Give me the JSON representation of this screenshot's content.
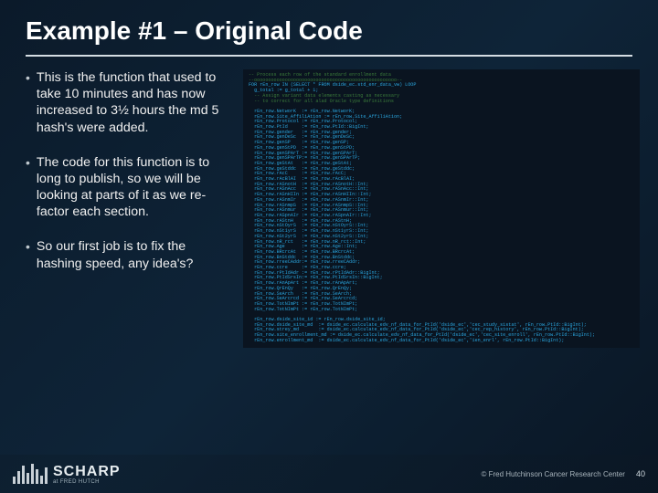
{
  "title": "Example #1 – Original Code",
  "bullets": [
    "This is the function that used to take 10 minutes and has now increased to 3½ hours the md 5 hash's were added.",
    "The code for this function is to long to publish, so we will be looking at parts of it as we re-factor each section.",
    "So our first job is to fix the hashing speed, any idea's?"
  ],
  "code": {
    "comment1": "-- Process each row of the standard enrollment data",
    "comment2": "--ooooooooooooooooooooooooooooooooooooooooooooooooooo--",
    "loop_open": "FOR rEn_row IN (SELECT * FROM dside_ec.std_enr_data_vw) LOOP",
    "counter": "  g_total := g_total + 1;",
    "comment3": "  -- Assign variant data elements casting as necessary",
    "comment4": "  -- to correct for all alad Oracle type definitions",
    "assigns": [
      "rEn_row.NetworK  := rEn_row.NetworK;",
      "rEn_row.Site_AffiliAtion := rEn_row.Site_AffiliAtion;",
      "rEn_row.Protocol := rEn_row.Protocol;",
      "rEn_row.PtId     := rEn_row.PtId::BigInt;",
      "rEn_row.gender   := rEn_row.gender;",
      "rEn_row.genDeSc  := rEn_row.genDeSc;",
      "rEn_row.genSP    := rEn_row.genSP;",
      "rEn_row.genStPD  := rEn_row.genStPD;",
      "rEn_row.genSPArT := rEn_row.genSPArT;",
      "rEn_row.genSPArTP:= rEn_row.genSPArTP;",
      "rEn_row.geStAt   := rEn_row.geStAt;",
      "rEn_row.geStddc  := rEn_row.geStddc;",
      "rEn_row.rAcC     := rEn_row.rAcC;",
      "rEn_row.rAcBlAI  := rEn_row.rAcBlAI;",
      "rEn_row.rASnotH  := rEn_row.rASnotH::Int;",
      "rEn_row.rASnAcc  := rEn_row.rASnAcc::Int;",
      "rEn_row.rASnHIIn := rEn_row.rASnHIIn::Int;",
      "rEn_row.rASnmIr  := rEn_row.rASnmIr::Int;",
      "rEn_row.rASnmpS  := rEn_row.rASnmpS::Int;",
      "rEn_row.rASnmur  := rEn_row.rASnmur::Int;",
      "rEn_row.rASpnAIr := rEn_row.rASpnAIr::Int;",
      "rEn_row.rAStnH   := rEn_row.rAStnH;",
      "rEn_row.nStOyrS  := rEn_row.nStOyrS::Int;",
      "rEn_row.nSt1yrS  := rEn_row.nSt1yrS::Int;",
      "rEn_row.nSt2yrS  := rEn_row.nSt2yrS::Int;",
      "rEn_row.nR_rct   := rEn_row.nR_rct::Int;",
      "rEn_row.Age      := rEn_row.Age::Int;",
      "rEn_row.BRcrcAt  := rEn_row.BRcrcAt;",
      "rEn_row.BnStddc  := rEn_row.BnStddc;",
      "rEn_row.rreeCAddr:= rEn_row.rreeCAddr;",
      "rEn_row.ccre     := rEn_row.ccre;",
      "rEn_row.rPtIdAdr := rEn_row.rPtIdAdr::BigInt;",
      "rEn_row.PtIdSrsIn:= rEn_row.PtIdSrsIn::BigInt;",
      "rEn_row.rAnApArt := rEn_row.rAnApArt;",
      "rEn_row.QrEnQy   := rEn_row.QrEnQy;",
      "rEn_row.SeArch   := rEn_row.SeArch;",
      "rEn_row.SeArcrcd := rEn_row.SeArcrcd;",
      "rEn_row.TotNImPt := rEn_row.TotNImPt;",
      "rEn_row.TotNImPt := rEn_row.TotNImPt;"
    ],
    "hash_lines": [
      "rEn_row.dside_site_id := rEn_row.dside_site_id;",
      "rEn_row.dside_site_md  := dside_ec.calculate_edv_nf_data_for_PtId('dside_ec','cec_study_sistat', rEn_row.PtId::BigInt);",
      "rEn_row.strey_md       := dside_ec.calculate_edv_nf_data_for_PtId('dside_ec','cec_rep_history', rEn_row.PtId::BigInt);",
      "rEn_row.site_enrollment_md := dside_ec.calculate_edv_nf_data_for_PtId('dside_ec','cec_site_enroll', rEn_row.PtId::BigInt);",
      "rEn_row.enrollment_md  := dside_ec.calculate_edv_nf_data_for_PtId('dside_ec','ien_enrl', rEn_row.PtId::BigInt);"
    ]
  },
  "logo": {
    "text": "SCHARP",
    "sub": "at FRED HUTCH"
  },
  "copyright": "© Fred Hutchinson Cancer Research Center",
  "page": "40"
}
